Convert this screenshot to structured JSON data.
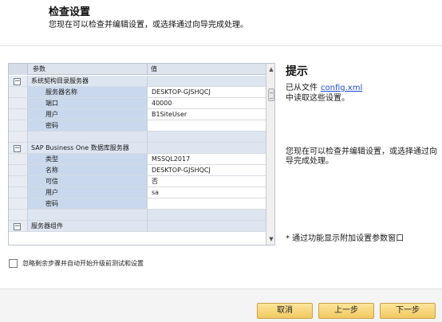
{
  "header": {
    "title": "检查设置",
    "subtitle": "您现在可以检查并编辑设置，或选择通过向导完成处理。"
  },
  "grid": {
    "columns": {
      "param": "参数",
      "value": "值"
    },
    "rows": [
      {
        "type": "group",
        "toggle": "−",
        "param": "系统契构目录服务器",
        "value": ""
      },
      {
        "type": "sub",
        "param": "服务器名称",
        "value": "DESKTOP-GJSHQCJ"
      },
      {
        "type": "sub",
        "param": "端口",
        "value": "40000"
      },
      {
        "type": "sub",
        "param": "用户",
        "value": "B1SiteUser"
      },
      {
        "type": "sub",
        "param": "密码",
        "value": ""
      },
      {
        "type": "blank",
        "param": "",
        "value": ""
      },
      {
        "type": "group",
        "toggle": "−",
        "param": "SAP Business One 数据库服务器",
        "value": ""
      },
      {
        "type": "sub",
        "param": "类型",
        "value": "MSSQL2017"
      },
      {
        "type": "sub",
        "param": "名称",
        "value": "DESKTOP-GJSHQCJ"
      },
      {
        "type": "sub",
        "param": "可信",
        "value": "否"
      },
      {
        "type": "sub",
        "param": "用户",
        "value": "sa"
      },
      {
        "type": "sub",
        "param": "密码",
        "value": ""
      },
      {
        "type": "blank",
        "param": "",
        "value": ""
      },
      {
        "type": "group",
        "toggle": "−",
        "param": "服务器组件",
        "value": ""
      }
    ],
    "scroll_up": "▲",
    "scroll_down": "▼"
  },
  "hint": {
    "title": "提示",
    "line1_prefix": "已从文件",
    "line1_link": "config.xml",
    "line2": "中读取这些设置。",
    "p1": "您现在可以检查并编辑设置，或选择通过向导完成处理。",
    "p2": "* 通过功能显示附加设置参数窗口"
  },
  "skip_option": {
    "label": "忽略剩余步骤并自动开始升级前测试和设置",
    "checked": false
  },
  "footer": {
    "cancel": "取消",
    "prev": "上一步",
    "next": "下一步"
  },
  "colors": {
    "button_fill": "#f2c960",
    "button_border": "#c9a24a",
    "link": "#1d4bd6",
    "param_cell": "#c9d8ec",
    "group_row": "#dde5f0"
  }
}
